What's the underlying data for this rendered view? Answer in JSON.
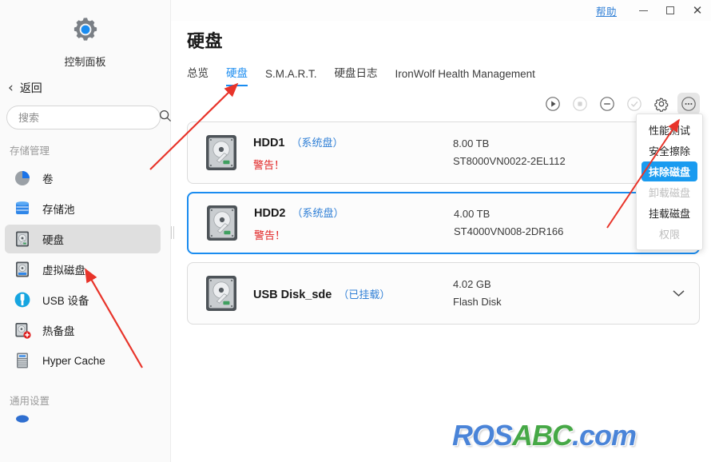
{
  "titlebar": {
    "help_label": "帮助",
    "minimize_icon": "minimize-icon",
    "maximize_icon": "maximize-icon",
    "close_icon": "close-icon"
  },
  "sidebar": {
    "control_panel_label": "控制面板",
    "back_label": "返回",
    "search_placeholder": "搜索",
    "search_value": "",
    "section_storage": "存储管理",
    "section_general": "通用设置",
    "items": [
      {
        "label": "卷",
        "icon": "volume-pie-icon",
        "active": false
      },
      {
        "label": "存储池",
        "icon": "storage-pool-icon",
        "active": false
      },
      {
        "label": "硬盘",
        "icon": "hard-disk-icon",
        "active": true
      },
      {
        "label": "虚拟磁盘",
        "icon": "virtual-disk-icon",
        "active": false
      },
      {
        "label": "USB 设备",
        "icon": "usb-device-icon",
        "active": false
      },
      {
        "label": "热备盘",
        "icon": "hot-spare-icon",
        "active": false
      },
      {
        "label": "Hyper Cache",
        "icon": "hyper-cache-icon",
        "active": false
      }
    ]
  },
  "main": {
    "page_title": "硬盘",
    "tabs": [
      {
        "label": "总览",
        "active": false
      },
      {
        "label": "硬盘",
        "active": true
      },
      {
        "label": "S.M.A.R.T.",
        "active": false
      },
      {
        "label": "硬盘日志",
        "active": false
      },
      {
        "label": "IronWolf Health Management",
        "active": false
      }
    ],
    "toolbar": [
      {
        "icon": "play-circle-icon",
        "disabled": false,
        "hover": false
      },
      {
        "icon": "stop-circle-icon",
        "disabled": true,
        "hover": false
      },
      {
        "icon": "minus-circle-icon",
        "disabled": false,
        "hover": false
      },
      {
        "icon": "check-circle-icon",
        "disabled": true,
        "hover": false
      },
      {
        "icon": "gear-icon",
        "disabled": false,
        "hover": false
      },
      {
        "icon": "ellipsis-circle-icon",
        "disabled": false,
        "hover": true
      }
    ],
    "disks": [
      {
        "name": "HDD1",
        "tag": "（系统盘）",
        "status": "警告！",
        "capacity": "8.00 TB",
        "model": "ST8000VN0022-2EL112",
        "selected": false,
        "expandable": false
      },
      {
        "name": "HDD2",
        "tag": "（系统盘）",
        "status": "警告！",
        "capacity": "4.00 TB",
        "model": "ST4000VN008-2DR166",
        "selected": true,
        "expandable": false
      },
      {
        "name": "USB Disk_sde",
        "tag": "（已挂载）",
        "status": "",
        "capacity": "4.02 GB",
        "model": "Flash Disk",
        "selected": false,
        "expandable": true
      }
    ],
    "dropdown": [
      {
        "label": "性能测试",
        "state": "normal"
      },
      {
        "label": "安全擦除",
        "state": "normal"
      },
      {
        "label": "抹除磁盘",
        "state": "selected"
      },
      {
        "label": "卸载磁盘",
        "state": "disabled"
      },
      {
        "label": "挂载磁盘",
        "state": "normal"
      },
      {
        "label": "权限",
        "state": "disabled"
      }
    ]
  },
  "watermark": {
    "part1": "ROS",
    "part2": "ABC",
    "part3": ".com"
  },
  "colors": {
    "accent": "#1a8cf0",
    "menu_selected": "#1a9bf0",
    "link": "#2f7fd6",
    "warning": "#e02020",
    "annotation": "#e8342a",
    "sidebar_bg": "#fafafa",
    "active_nav_bg": "#dfdfdf"
  }
}
